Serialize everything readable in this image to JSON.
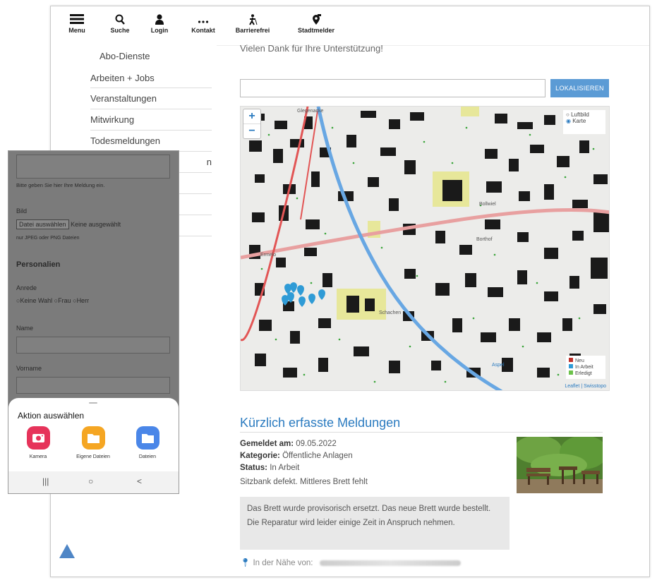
{
  "nav": {
    "items": [
      {
        "label": "Menu",
        "icon": "hamburger-icon"
      },
      {
        "label": "Suche",
        "icon": "search-icon"
      },
      {
        "label": "Login",
        "icon": "user-icon"
      },
      {
        "label": "Kontakt",
        "icon": "dots-icon"
      },
      {
        "label": "Barrierefrei",
        "icon": "accessibility-icon"
      },
      {
        "label": "Stadtmelder",
        "icon": "location-pin-icon"
      }
    ]
  },
  "sidemenu": {
    "items": [
      "Abo-Dienste",
      "Arbeiten + Jobs",
      "Veranstaltungen",
      "Mitwirkung",
      "Todesmeldungen"
    ],
    "partial_label": "n"
  },
  "main": {
    "thanks": "Vielen Dank für Ihre Unterstützung!",
    "localize_button": "LOKALISIEREN"
  },
  "map": {
    "layer_options": [
      "Luftbild",
      "Karte"
    ],
    "selected_layer": "Karte",
    "place_labels": [
      "Glegenacke",
      "Bollwiel",
      "Borthof",
      "Ermelo",
      "Schachen",
      "Aspel"
    ],
    "legend": [
      {
        "label": "Neu",
        "color": "#c0312b"
      },
      {
        "label": "In Arbeit",
        "color": "#2f9bd6"
      },
      {
        "label": "Erledigt",
        "color": "#6cc24a"
      }
    ],
    "attribution": "Leaflet | Swisstopo"
  },
  "recent": {
    "title": "Kürzlich erfasste Meldungen",
    "reported_label": "Gemeldet am:",
    "reported_value": "09.05.2022",
    "category_label": "Kategorie:",
    "category_value": "Öffentliche Anlagen",
    "status_label": "Status:",
    "status_value": "In Arbeit",
    "description": "Sitzbank defekt. Mittleres Brett fehlt",
    "reply": "Das Brett wurde provisorisch ersetzt. Das neue Brett wurde bestellt. Die Reparatur wird leider einige Zeit in Anspruch nehmen.",
    "nearby_label": "In der Nähe von:"
  },
  "phone": {
    "message_hint": "Bitte geben Sie hier Ihre Meldung ein.",
    "image_label": "Bild",
    "file_button": "Datei auswählen",
    "file_status": "Keine ausgewählt",
    "file_hint": "nur JPEG oder PNG Dateien",
    "personal_heading": "Personalien",
    "salutation_label": "Anrede",
    "salutation_options": [
      "Keine Wahl",
      "Frau",
      "Herr"
    ],
    "name_label": "Name",
    "firstname_label": "Vorname",
    "sheet_title": "Aktion auswählen",
    "actions": [
      {
        "label": "Kamera",
        "color": "#e6335a"
      },
      {
        "label": "Eigene Dateien",
        "color": "#f5a623"
      },
      {
        "label": "Dateien",
        "color": "#4a86e8"
      }
    ],
    "navbar": [
      "|||",
      "○",
      "<"
    ]
  }
}
